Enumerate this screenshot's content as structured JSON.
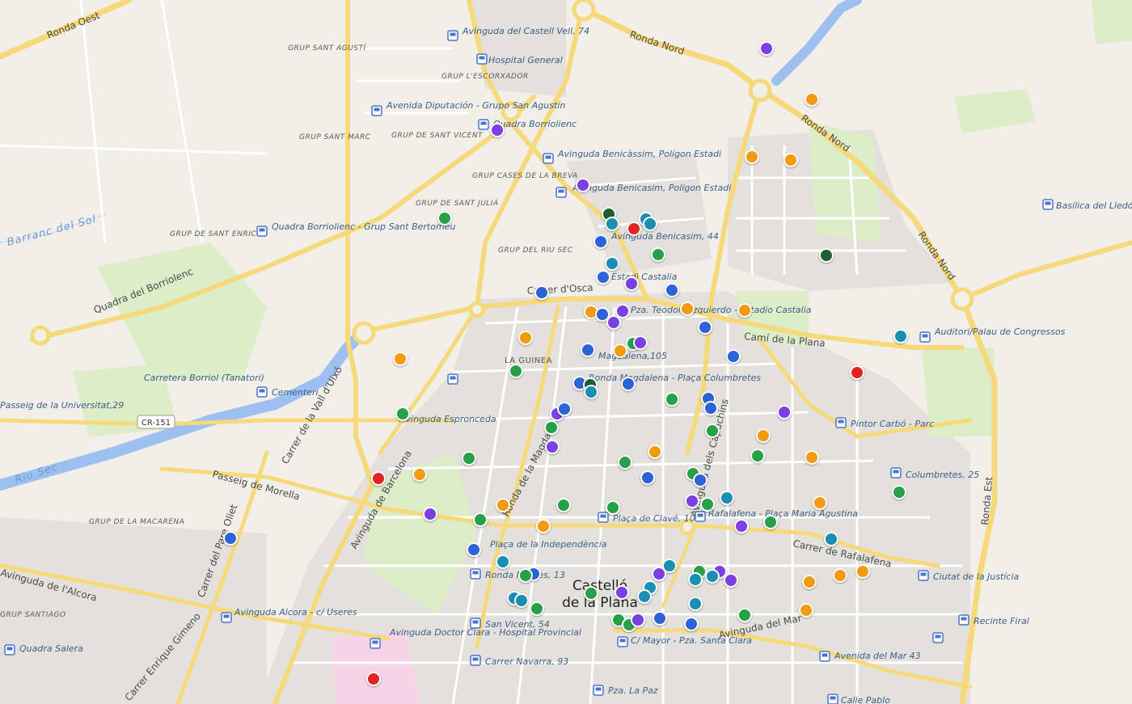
{
  "map": {
    "city_label": [
      "Castelló",
      "de la Plana"
    ],
    "water_labels": [
      "Barranc del Sol",
      "Riu Sec"
    ],
    "road_shield": "CR-151",
    "streets": [
      "Ronda Oest",
      "Ronda Nord",
      "Ronda Nord",
      "Ronda Nord",
      "Ronda Est",
      "Quadra del Borriolenc",
      "Carrer de la Vall d'Uixó",
      "Passeig de Morella",
      "Avinguda de Barcelona",
      "Ronda de la Magdalena",
      "Carrer del Pare Oliet",
      "Avinguda de l'Alcora",
      "Carrer Enrique Gimeno",
      "Camí de la Plana",
      "Carrer de Rafalafena",
      "Avinguda del Mar",
      "Avinguda dels Capuchins",
      "Carrer d'Osca"
    ],
    "areas": [
      "GRUP SANT AGUSTÍ",
      "GRUP L'ESCORXADOR",
      "GRUP SANT MARC",
      "GRUP DE SANT VICENT",
      "GRUP CASES DE LA BREVA",
      "GRUP DE SANT JULIÀ",
      "GRUP DE SANT ENRIC",
      "GRUP DEL RIU SEC",
      "LA GUINEA",
      "GRUP DE LA MACARENA",
      "GRUP SANTIAGO"
    ],
    "stops": [
      "Avinguda del Castell Vell, 74",
      "Hospital General",
      "Avenida Diputación - Grupo San Agustín",
      "Quadra Borriolienc",
      "Avinguda Benicàssim, Polígon Estadi",
      "Avinguda Benicasim, Polígon Estadi",
      "Avinguda Benicasim, 44",
      "Quadra Borriolienc - Grup Sant Bertomeu",
      "Estadi Castalia",
      "Pza. Teodoro Izquierdo - Estadio Castalia",
      "Magdalena,105",
      "Ronda Magdalena - Plaça Columbretes",
      "Carretera Borriol (Tanatori)",
      "Cementeri",
      "Passeig de la Universitat,29",
      "Avinguda Espronceda",
      "Auditori/Palau de Congressos",
      "Basílica del Lledó",
      "Pintor Carbó - Parc",
      "Columbretes, 25",
      "Plaça de Clavé, 10",
      "Rafalafena - Plaça Maria Agustina",
      "Plaça de la Independència",
      "Ronda Mijares, 13",
      "Ciutat de la Justícia",
      "Avinguda Alcora - c/ Useres",
      "Quadra Salera",
      "Avinguda Doctor Clara - Hospital Provincial",
      "San Vicent, 54",
      "Carrer Navarra, 93",
      "C/ Mayor - Pza. Santa Clara",
      "Avenida del Mar 43",
      "Recinte Firal",
      "Pza. La Paz",
      "Calle Pablo"
    ],
    "colors": {
      "background": "#f2efe9",
      "park": "#dcedc8",
      "water": "#9ec0f0",
      "major_road": "#f5d97a",
      "urban": "#e4e1dc",
      "marker_purple": "#7b3fe4",
      "marker_blue": "#2e62d9",
      "marker_teal": "#1a8fb3",
      "marker_green": "#27a048",
      "marker_orange": "#f29a11",
      "marker_red": "#e02424",
      "marker_darkgreen": "#1f5e2e"
    },
    "marker_groups": {
      "purple": 19,
      "blue": 28,
      "teal": 18,
      "green": 31,
      "orange": 25,
      "red": 4,
      "darkgreen": 4
    }
  }
}
